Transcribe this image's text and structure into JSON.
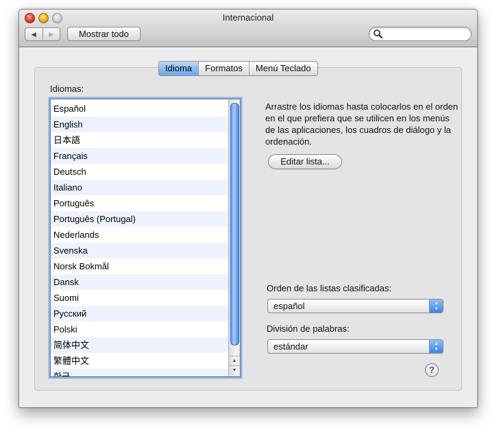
{
  "window": {
    "title": "Internacional"
  },
  "toolbar": {
    "back_glyph": "◀",
    "forward_glyph": "▶",
    "show_all_label": "Mostrar todo",
    "search_placeholder": "",
    "search_value": ""
  },
  "tabs": [
    {
      "label": "Idioma",
      "active": true
    },
    {
      "label": "Formatos",
      "active": false
    },
    {
      "label": "Menú Teclado",
      "active": false
    }
  ],
  "languages": {
    "label": "Idiomas:",
    "items": [
      "Español",
      "English",
      "日本語",
      "Français",
      "Deutsch",
      "Italiano",
      "Português",
      "Português (Portugal)",
      "Nederlands",
      "Svenska",
      "Norsk Bokmål",
      "Dansk",
      "Suomi",
      "Русский",
      "Polski",
      "简体中文",
      "繁體中文",
      "한국"
    ]
  },
  "instructions": {
    "text": "Arrastre los idiomas hasta colocarlos en el orden en el que prefiera que se utilicen en los menús de las aplicaciones, los cuadros de diálogo y la ordenación."
  },
  "edit_list": {
    "label": "Editar lista..."
  },
  "sort_order": {
    "label": "Orden de las listas clasificadas:",
    "value": "español"
  },
  "word_break": {
    "label": "División de palabras:",
    "value": "estándar"
  },
  "help": {
    "glyph": "?"
  },
  "colors": {
    "selected_tab": "#8bbcf0",
    "scroll_thumb": "#79aef4",
    "popup_arrows": "#3d84e6",
    "help_mark": "#6a2fb5"
  },
  "icons": {
    "search": "magnifier-icon",
    "back": "back-arrow-icon",
    "forward": "forward-arrow-icon",
    "popup": "up-down-arrows-icon"
  }
}
